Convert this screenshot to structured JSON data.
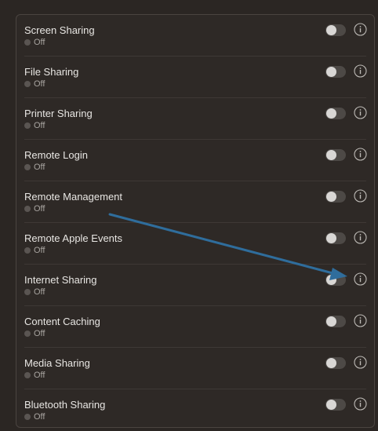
{
  "sharing": {
    "items": [
      {
        "label": "Screen Sharing",
        "status": "Off",
        "enabled": false
      },
      {
        "label": "File Sharing",
        "status": "Off",
        "enabled": false
      },
      {
        "label": "Printer Sharing",
        "status": "Off",
        "enabled": false
      },
      {
        "label": "Remote Login",
        "status": "Off",
        "enabled": false
      },
      {
        "label": "Remote Management",
        "status": "Off",
        "enabled": false
      },
      {
        "label": "Remote Apple Events",
        "status": "Off",
        "enabled": false
      },
      {
        "label": "Internet Sharing",
        "status": "Off",
        "enabled": false
      },
      {
        "label": "Content Caching",
        "status": "Off",
        "enabled": false
      },
      {
        "label": "Media Sharing",
        "status": "Off",
        "enabled": false
      },
      {
        "label": "Bluetooth Sharing",
        "status": "Off",
        "enabled": false
      }
    ]
  },
  "annotation": {
    "icon": "arrow-annotation",
    "color": "#2f6d9c",
    "points_to": "Internet Sharing"
  },
  "colors": {
    "background": "#2b2623",
    "text": "#e8e6e3",
    "subtext": "#a8a4a0"
  }
}
